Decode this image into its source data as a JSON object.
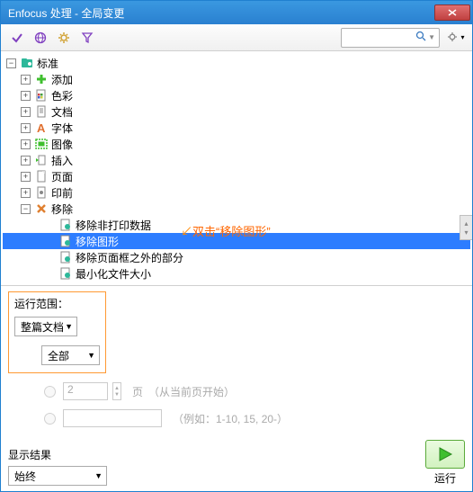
{
  "window": {
    "title": "Enfocus 处理 - 全局变更"
  },
  "toolbar": {
    "search_placeholder": ""
  },
  "tree": {
    "root": "标准",
    "items": [
      {
        "label": "添加",
        "icon": "plus"
      },
      {
        "label": "色彩",
        "icon": "doc-color"
      },
      {
        "label": "文档",
        "icon": "doc"
      },
      {
        "label": "字体",
        "icon": "font"
      },
      {
        "label": "图像",
        "icon": "image"
      },
      {
        "label": "插入",
        "icon": "insert"
      },
      {
        "label": "页面",
        "icon": "page"
      },
      {
        "label": "印前",
        "icon": "prepress"
      }
    ],
    "remove": {
      "label": "移除",
      "children": [
        "移除非打印数据",
        "移除图形",
        "移除页面框之外的部分",
        "最小化文件大小"
      ]
    }
  },
  "annotation": "双击“移除图形”",
  "scope": {
    "label": "运行范围：",
    "whole_doc": "整篇文档",
    "all": "全部",
    "pages_unit": "页",
    "pages_hint": "（从当前页开始）",
    "page_num": "2",
    "example_hint": "（例如：1-10, 15, 20-）"
  },
  "result": {
    "label": "显示结果",
    "option": "始终"
  },
  "run_label": "运行"
}
